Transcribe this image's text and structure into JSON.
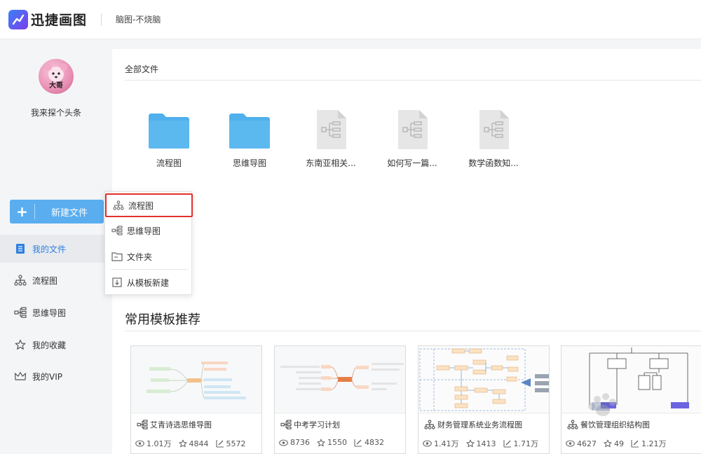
{
  "header": {
    "app_title": "迅捷画图",
    "slogan": "脑图-不烧脑"
  },
  "sidebar": {
    "avatar_text": "大哥",
    "username": "我来探个头条",
    "new_button_label": "新建文件",
    "nav": [
      {
        "label": "我的文件",
        "icon": "document-icon",
        "active": true
      },
      {
        "label": "流程图",
        "icon": "flowchart-icon"
      },
      {
        "label": "思维导图",
        "icon": "mindmap-icon"
      },
      {
        "label": "我的收藏",
        "icon": "star-icon"
      },
      {
        "label": "我的VIP",
        "icon": "crown-icon"
      }
    ]
  },
  "main": {
    "section_title": "全部文件",
    "files": [
      {
        "name": "流程图",
        "type": "folder"
      },
      {
        "name": "思维导图",
        "type": "folder"
      },
      {
        "name": "东南亚相关...",
        "type": "mindmap-file"
      },
      {
        "name": "如何写一篇...",
        "type": "mindmap-file"
      },
      {
        "name": "数学函数知...",
        "type": "mindmap-file"
      }
    ],
    "templates_title": "常用模板推荐",
    "templates": [
      {
        "name": "艾青诗选思维导图",
        "icon": "mindmap-icon",
        "views": "1.01万",
        "stars": "4844",
        "uses": "5572"
      },
      {
        "name": "中考学习计划",
        "icon": "mindmap-icon",
        "views": "8736",
        "stars": "1550",
        "uses": "4832"
      },
      {
        "name": "财务管理系统业务流程图",
        "icon": "flowchart-icon",
        "views": "1.41万",
        "stars": "1413",
        "uses": "1.71万"
      },
      {
        "name": "餐饮管理组织结构图",
        "icon": "flowchart-icon",
        "views": "4627",
        "stars": "49",
        "uses": "1.21万"
      }
    ]
  },
  "dropdown": {
    "items": [
      {
        "label": "流程图",
        "icon": "flowchart-icon",
        "selected": true
      },
      {
        "label": "思维导图",
        "icon": "mindmap-icon"
      },
      {
        "label": "文件夹",
        "icon": "folder-icon"
      },
      {
        "label": "从模板新建",
        "icon": "template-icon"
      }
    ]
  },
  "colors": {
    "accent": "#2f7fe0",
    "button": "#5aaef0",
    "folder": "#4fb0ec",
    "highlight": "#e0312c"
  }
}
